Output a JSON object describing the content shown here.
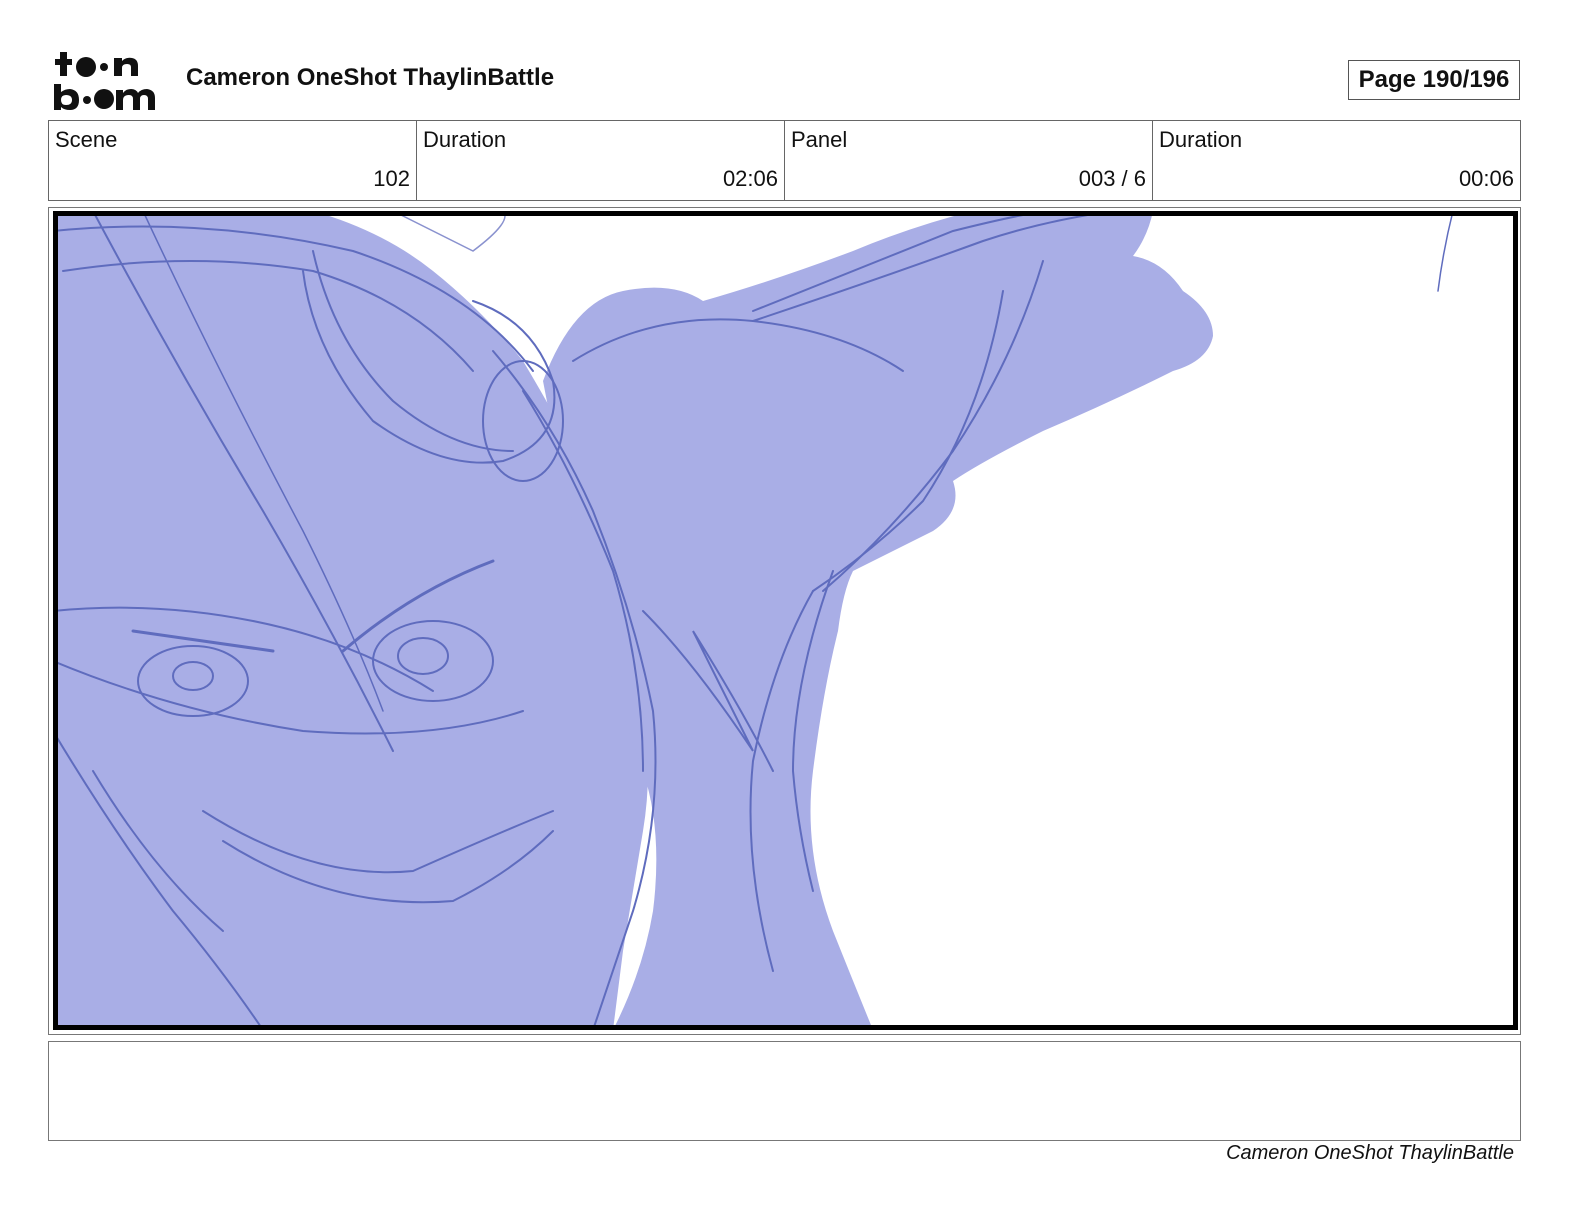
{
  "header": {
    "logo_line1": "to•n",
    "logo_line2": "b••m",
    "title": "Cameron OneShot ThaylinBattle",
    "page_label": "Page 190/196"
  },
  "info": [
    {
      "label": "Scene",
      "value": "102"
    },
    {
      "label": "Duration",
      "value": "02:06"
    },
    {
      "label": "Panel",
      "value": "003 / 6"
    },
    {
      "label": "Duration",
      "value": "00:06"
    }
  ],
  "panel": {
    "fill_color": "#a9aee6",
    "line_color": "#5f6cbe"
  },
  "footer": {
    "text": "Cameron OneShot ThaylinBattle"
  }
}
